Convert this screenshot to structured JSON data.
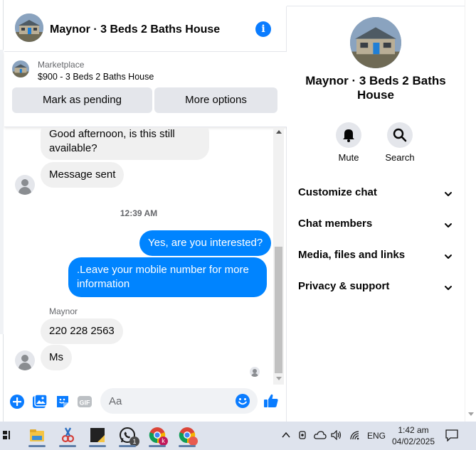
{
  "chat": {
    "title": "Maynor · 3 Beds 2 Baths House",
    "info_icon": "info-icon",
    "marketplace": {
      "label": "Marketplace",
      "item": "$900 - 3 Beds 2 Baths House",
      "pending_button": "Mark as pending",
      "more_button": "More options"
    },
    "messages": [
      {
        "direction": "in",
        "text": "Good afternoon, is this still available?"
      },
      {
        "direction": "in",
        "text": "Message sent"
      },
      {
        "type": "timestamp",
        "text": "12:39 AM"
      },
      {
        "direction": "out",
        "text": "Yes, are you interested?"
      },
      {
        "direction": "out",
        "text": ".Leave your mobile number for more information"
      },
      {
        "type": "sender",
        "text": "Maynor"
      },
      {
        "direction": "in",
        "text": "220 228 2563"
      },
      {
        "direction": "in",
        "text": "Ms"
      }
    ],
    "composer": {
      "placeholder": "Aa",
      "icons": [
        "plus-icon",
        "photo-icon",
        "sticker-icon",
        "gif-icon",
        "emoji-icon",
        "like-icon"
      ]
    }
  },
  "info_panel": {
    "title": "Maynor · 3 Beds 2 Baths House",
    "actions": [
      {
        "label": "Mute",
        "icon": "bell-icon"
      },
      {
        "label": "Search",
        "icon": "search-icon"
      }
    ],
    "sections": [
      {
        "label": "Customize chat"
      },
      {
        "label": "Chat members"
      },
      {
        "label": "Media, files and links"
      },
      {
        "label": "Privacy & support"
      }
    ]
  },
  "taskbar": {
    "apps": [
      "task-view-icon",
      "file-explorer-icon",
      "snipping-tool-icon",
      "sticky-notes-icon",
      "whatsapp-icon",
      "chrome-profile-k-icon",
      "chrome-icon"
    ],
    "whatsapp_badge": "1",
    "chrome_badge": "k",
    "language": "ENG",
    "time": "1:42 am",
    "date": "04/02/2025"
  },
  "colors": {
    "messenger_blue": "#0084ff",
    "accent_blue": "#0a7cff",
    "bubble_gray": "#f0f0f0",
    "taskbar": "#dee3ed"
  }
}
